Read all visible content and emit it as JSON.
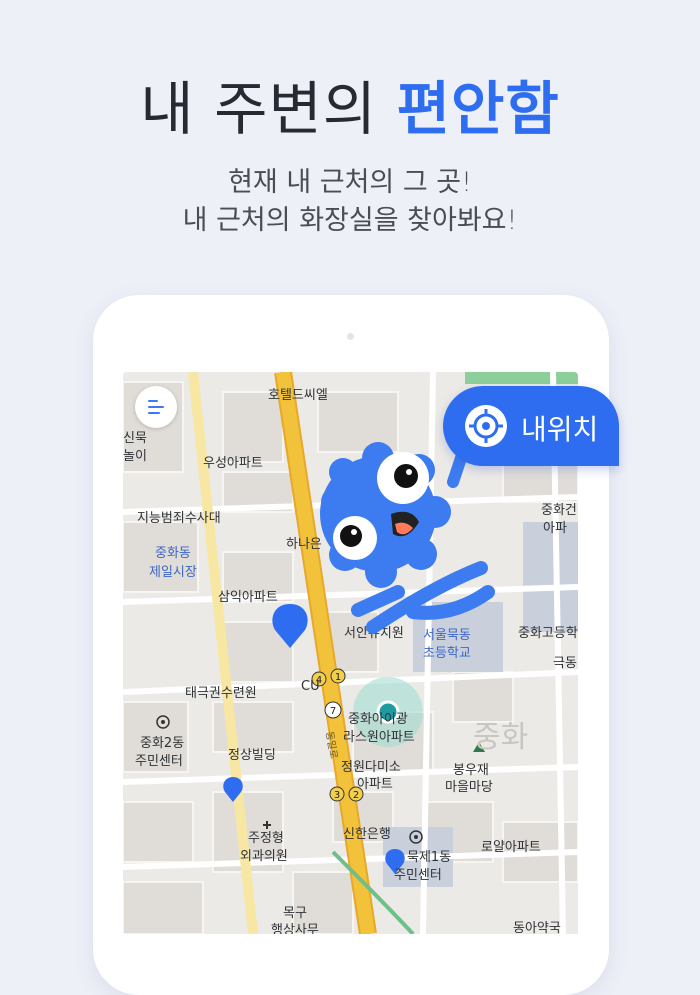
{
  "header": {
    "title_part1": "내 주변의 ",
    "title_accent": "편안함",
    "subtitle_line1": "현재 내 근처의 그 곳!",
    "subtitle_line2": "내 근처의 화장실을 찾아봐요!"
  },
  "controls": {
    "my_location_label": "내위치"
  },
  "map": {
    "labels": {
      "hotel": "호텔드씨엘",
      "woosung": "우성아파트",
      "jineung": "지능범죄수사대",
      "junghwadong_market_1": "중화동",
      "junghwadong_market_2": "제일시장",
      "hana": "하나은",
      "samik": "삼익아파트",
      "seoan": "서안유치원",
      "seoulmukdong_1": "서울묵동",
      "seoulmukdong_2": "초등학교",
      "junghwa_hs": "중화고등학",
      "taegeuk": "태극권수련원",
      "junghwa2_1": "중화2동",
      "junghwa2_2": "주민센터",
      "jungsang": "정상빌딩",
      "junghwa_apt_1": "중화아이광",
      "junghwa_apt_2": "라스원아파트",
      "jungwon_1": "정원다미소",
      "jungwon_2": "아파트",
      "bongujae_1": "봉우재",
      "bongujae_2": "마을마당",
      "shinhan": "신한은행",
      "jujeong_1": "주정형",
      "jujeong_2": "외과의원",
      "mukje_1": "묵제1동",
      "mukje_2": "주민센터",
      "royal": "로얄아파트",
      "jungwha_big": "중화",
      "junghwa_apt_right_1": "중화건",
      "junghwa_apt_right_2": "아파",
      "gukdong": "극동",
      "donga": "동아약국",
      "mukgu_1": "목구",
      "mukgu_2": "행상사무",
      "sinmuk_1": "신묵",
      "sinmuk_2": "놀이",
      "cu": "CU",
      "road_name": "동일로",
      "bus_1": "1",
      "bus_4": "4",
      "bus_2": "2",
      "bus_3": "3",
      "route_7": "7"
    }
  },
  "colors": {
    "accent": "#2f6df0",
    "mascot": "#3d7cf0",
    "road_major": "#f2c23a",
    "map_bg": "#eceae6"
  }
}
